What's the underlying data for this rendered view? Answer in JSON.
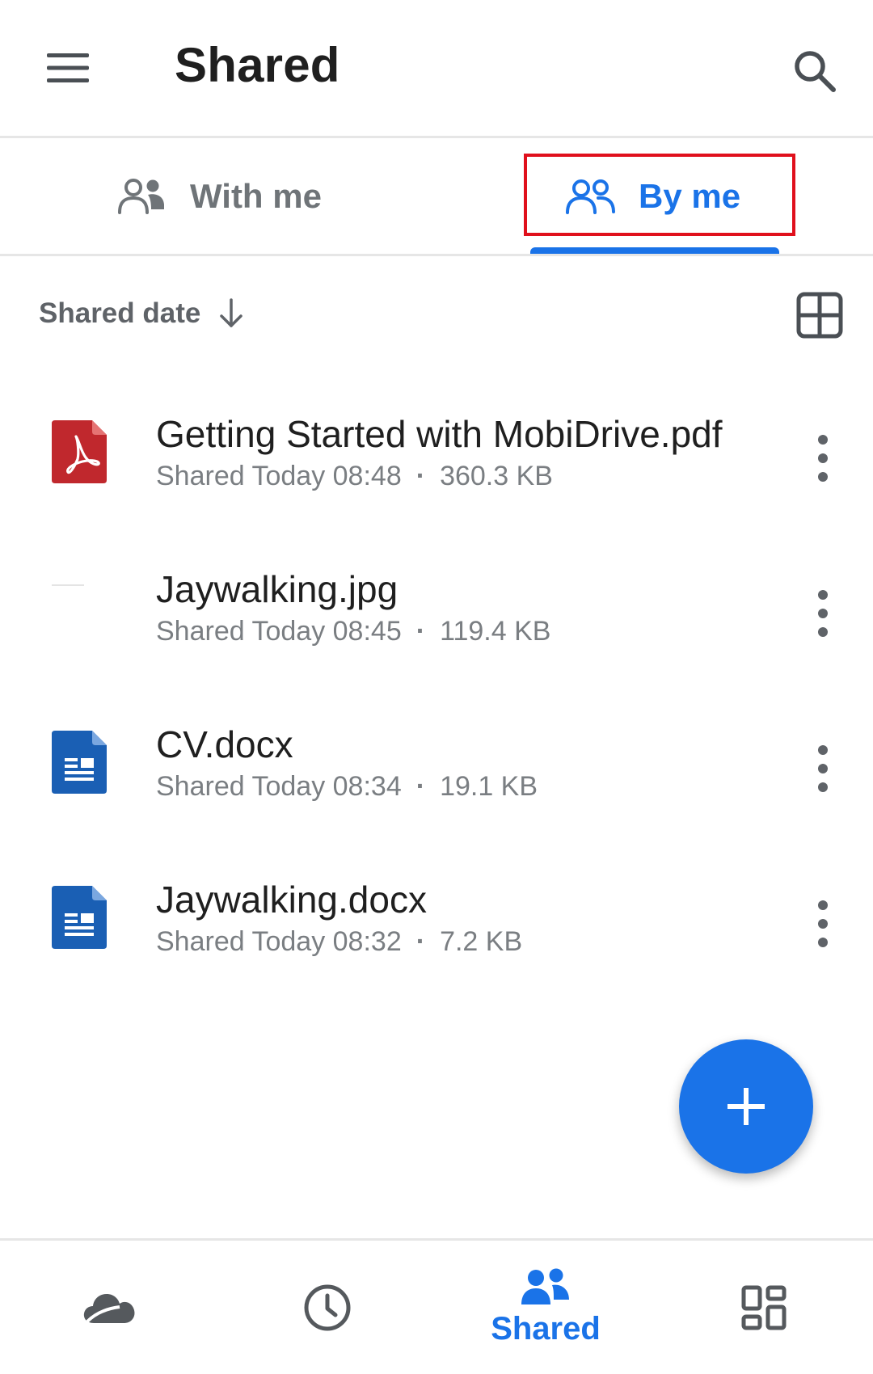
{
  "header": {
    "title": "Shared",
    "menu_icon": "hamburger-menu-icon",
    "search_icon": "search-icon"
  },
  "tabs": [
    {
      "label": "With me",
      "icon": "people-icon",
      "selected": false
    },
    {
      "label": "By me",
      "icon": "people-outline-icon",
      "selected": true
    }
  ],
  "sort": {
    "label": "Shared date",
    "direction_icon": "arrow-down-icon",
    "view_toggle_icon": "grid-view-icon"
  },
  "files": [
    {
      "name": "Getting Started with MobiDrive.pdf",
      "shared": "Shared Today 08:48",
      "size": "360.3 KB",
      "icon": "pdf-file-icon"
    },
    {
      "name": "Jaywalking.jpg",
      "shared": "Shared Today 08:45",
      "size": "119.4 KB",
      "icon": "image-thumbnail-icon"
    },
    {
      "name": "CV.docx",
      "shared": "Shared Today 08:34",
      "size": "19.1 KB",
      "icon": "document-file-icon"
    },
    {
      "name": "Jaywalking.docx",
      "shared": "Shared Today 08:32",
      "size": "7.2 KB",
      "icon": "document-file-icon"
    }
  ],
  "fab": {
    "icon": "plus-icon"
  },
  "bottom_nav": [
    {
      "icon": "cloud-icon",
      "label": "",
      "active": false
    },
    {
      "icon": "clock-icon",
      "label": "",
      "active": false
    },
    {
      "icon": "shared-people-icon",
      "label": "Shared",
      "active": true
    },
    {
      "icon": "apps-grid-icon",
      "label": "",
      "active": false
    }
  ],
  "colors": {
    "accent": "#1a73e8",
    "highlight": "#e0101c",
    "pdf": "#c0282d",
    "doc": "#1a5fb4",
    "text_primary": "#1f1f1f",
    "text_secondary": "#7a7e82"
  }
}
